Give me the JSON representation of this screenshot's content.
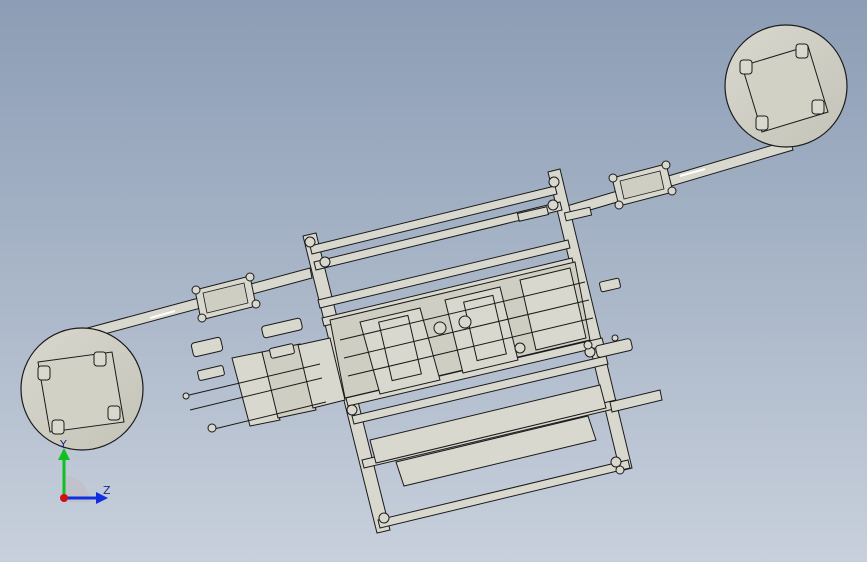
{
  "triad": {
    "y_label": "Y",
    "z_label": "Z",
    "x_color": "#d01010",
    "y_color": "#10c020",
    "z_color": "#1030e0"
  },
  "colors": {
    "part_fill": "#d8d7cc",
    "part_stroke": "#1a1a1a",
    "shade_fill": "#b9b8ad"
  }
}
